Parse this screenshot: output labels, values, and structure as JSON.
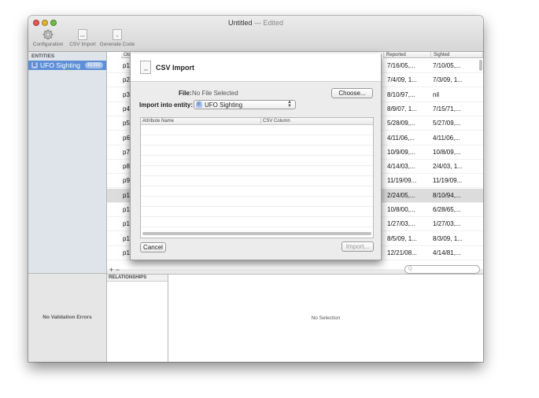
{
  "window": {
    "title": "Untitled",
    "edited": "— Edited"
  },
  "toolbar": {
    "configuration": "Configuration",
    "csv_import": "CSV Import",
    "generate_code": "Generate Code",
    "csv_icon_text": "CSV",
    "code_icon_text": "M"
  },
  "sidebar": {
    "header": "ENTITIES",
    "entity": {
      "name": "UFO Sighting",
      "badge": "61392",
      "icon": "E"
    },
    "no_validation": "No Validation Errors"
  },
  "table": {
    "col_obj": "Obj",
    "col_reported": "Reported",
    "col_sighted": "Sighted",
    "rows": [
      {
        "obj": "p1",
        "reported": "7/16/05,...",
        "sighted": "7/10/05,...",
        "selected": false
      },
      {
        "obj": "p2",
        "reported": "7/4/09, 1...",
        "sighted": "7/3/09, 1...",
        "selected": false
      },
      {
        "obj": "p3",
        "reported": "8/10/97,...",
        "sighted": "nil",
        "selected": false
      },
      {
        "obj": "p4",
        "reported": "8/9/07, 1...",
        "sighted": "7/15/71,...",
        "selected": false
      },
      {
        "obj": "p5",
        "reported": "5/28/09,...",
        "sighted": "5/27/09,...",
        "selected": false
      },
      {
        "obj": "p6",
        "reported": "4/11/06,...",
        "sighted": "4/11/06,...",
        "selected": false
      },
      {
        "obj": "p7",
        "reported": "10/9/09,...",
        "sighted": "10/8/09,...",
        "selected": false
      },
      {
        "obj": "p8",
        "reported": "4/14/03,...",
        "sighted": "2/4/03, 1...",
        "selected": false
      },
      {
        "obj": "p9",
        "reported": "11/19/09...",
        "sighted": "11/19/09...",
        "selected": false
      },
      {
        "obj": "p1",
        "reported": "2/24/05,...",
        "sighted": "8/10/94,...",
        "selected": true
      },
      {
        "obj": "p1",
        "reported": "10/8/00,...",
        "sighted": "6/28/65,...",
        "selected": false
      },
      {
        "obj": "p1",
        "reported": "1/27/03,...",
        "sighted": "1/27/03,...",
        "selected": false
      },
      {
        "obj": "p1",
        "reported": "8/5/09, 1...",
        "sighted": "8/3/09, 1...",
        "selected": false
      },
      {
        "obj": "p1",
        "reported": "12/21/08...",
        "sighted": "4/14/81,...",
        "selected": false
      }
    ],
    "plus_minus": "+ −",
    "search_placeholder": "Q"
  },
  "relationships": {
    "header": "RELATIONSHIPS",
    "no_selection": "No Selection"
  },
  "sheet": {
    "title": "CSV Import",
    "icon_text": ".csv",
    "file_label": "File:",
    "file_value": "No File Selected",
    "choose": "Choose...",
    "entity_label": "Import into entity:",
    "entity_value": "UFO Sighting",
    "entity_icon": "E",
    "col_attribute": "Attribute Name",
    "col_csv": "CSV Column",
    "cancel": "Cancel",
    "import": "Import..."
  }
}
